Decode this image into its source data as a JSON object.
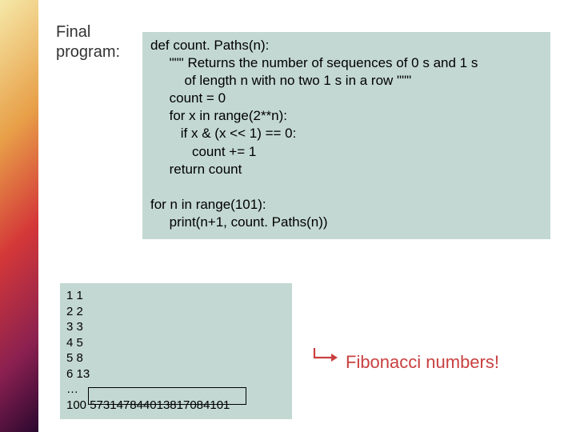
{
  "title_line1": "Final",
  "title_line2": "program:",
  "code": "def count. Paths(n):\n     \"\"\" Returns the number of sequences of 0 s and 1 s\n         of length n with no two 1 s in a row \"\"\"\n     count = 0\n     for x in range(2**n):\n        if x & (x << 1) == 0:\n           count += 1\n     return count\n\nfor n in range(101):\n     print(n+1, count. Paths(n))",
  "output": "1 1\n2 2\n3 3\n4 5\n5 8\n6 13\n…\n100 573147844013817084101",
  "annotation": "Fibonacci numbers!"
}
